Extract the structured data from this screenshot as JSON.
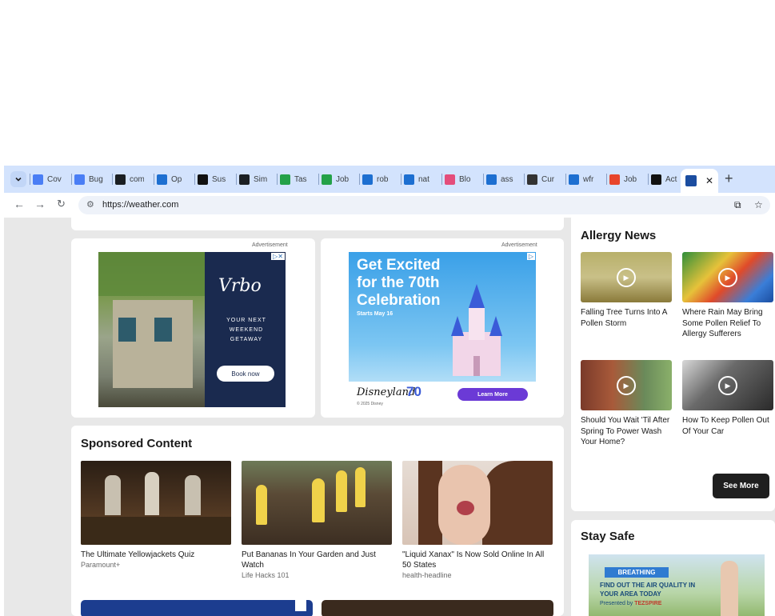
{
  "browser": {
    "tabs": [
      {
        "label": "Cov",
        "icon": "docs-icon",
        "color": "#4a7ef5"
      },
      {
        "label": "Bug",
        "icon": "docs-icon",
        "color": "#4a7ef5"
      },
      {
        "label": "com",
        "icon": "github-icon",
        "color": "#1b1f23"
      },
      {
        "label": "Op",
        "icon": "workday-icon",
        "color": "#1d6fd1"
      },
      {
        "label": "Sus",
        "icon": "notion-icon",
        "color": "#111111"
      },
      {
        "label": "Sim",
        "icon": "github-icon",
        "color": "#1b1f23"
      },
      {
        "label": "Tas",
        "icon": "greenhouse-icon",
        "color": "#24a148"
      },
      {
        "label": "Job",
        "icon": "greenhouse-icon",
        "color": "#24a148"
      },
      {
        "label": "rob",
        "icon": "workday-icon",
        "color": "#1d6fd1"
      },
      {
        "label": "nat",
        "icon": "workday-icon",
        "color": "#1d6fd1"
      },
      {
        "label": "Blo",
        "icon": "blog-icon",
        "color": "#e44d7b"
      },
      {
        "label": "ass",
        "icon": "workday-icon",
        "color": "#1d6fd1"
      },
      {
        "label": "Cur",
        "icon": "pen-icon",
        "color": "#333333"
      },
      {
        "label": "wfr",
        "icon": "workday-icon",
        "color": "#1d6fd1"
      },
      {
        "label": "Job",
        "icon": "grid-icon",
        "color": "#e8452c"
      },
      {
        "label": "Act",
        "icon": "openai-icon",
        "color": "#111111"
      }
    ],
    "active_tab": {
      "label": "",
      "icon": "weather-channel-icon",
      "color": "#1b4da0"
    },
    "url": "https://weather.com"
  },
  "ads": {
    "label_left": "Advertisement",
    "label_right": "Advertisement",
    "vrbo": {
      "logo": "Vrbo",
      "tagline_1": "YOUR NEXT",
      "tagline_2": "WEEKEND",
      "tagline_3": "GETAWAY",
      "button": "Book now"
    },
    "disney": {
      "headline_1": "Get Excited",
      "headline_2": "for the 70th",
      "headline_3": "Celebration",
      "starts": "Starts May 16",
      "brand": "Disneyland",
      "seventy": "70",
      "button": "Learn More",
      "copyright": "© 2025 Disney"
    },
    "breathing": {
      "badge": "BREATHING",
      "text": "FIND OUT THE AIR QUALITY IN YOUR AREA TODAY",
      "presented": "Presented by",
      "sponsor": "TEZSPIRE"
    }
  },
  "sponsored": {
    "title": "Sponsored Content",
    "items": [
      {
        "title": "The Ultimate Yellowjackets Quiz",
        "source": "Paramount+"
      },
      {
        "title": "Put Bananas In Your Garden and Just Watch",
        "source": "Life Hacks 101"
      },
      {
        "title": "\"Liquid Xanax\" Is Now Sold Online In All 50 States",
        "source": "health-headline"
      }
    ]
  },
  "allergy": {
    "title": "Allergy News",
    "items": [
      {
        "title": "Falling Tree Turns Into A Pollen Storm"
      },
      {
        "title": "Where Rain May Bring Some Pollen Relief To Allergy Sufferers"
      },
      {
        "title": "Should You Wait 'Til After Spring To Power Wash Your Home?"
      },
      {
        "title": "How To Keep Pollen Out Of Your Car"
      }
    ],
    "see_more": "See More"
  },
  "stay_safe": {
    "title": "Stay Safe"
  }
}
